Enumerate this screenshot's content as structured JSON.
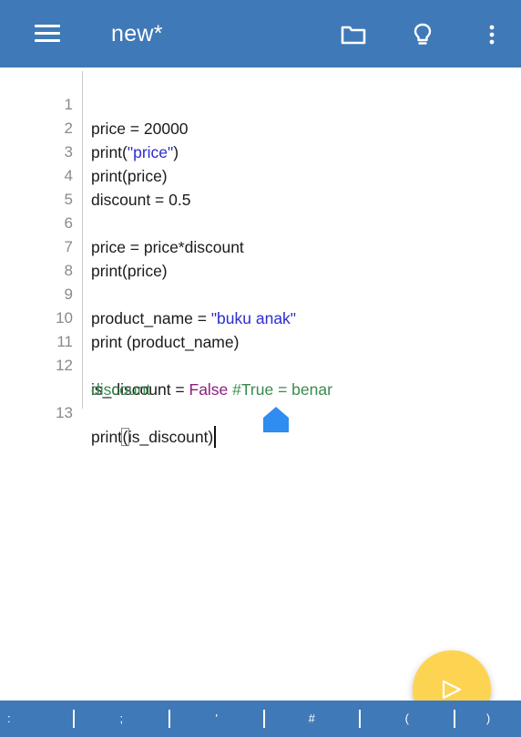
{
  "app_bar": {
    "title": "new*",
    "icons": [
      "menu-icon",
      "folder-icon",
      "lightbulb-icon",
      "more-vert-icon"
    ],
    "color": "#3f79b7"
  },
  "editor": {
    "lines": [
      {
        "num": "1",
        "text": "price = 20000"
      },
      {
        "num": "2",
        "prefix": "print(",
        "string": "\"price\"",
        "suffix": ")"
      },
      {
        "num": "3",
        "text": "print(price)"
      },
      {
        "num": "4",
        "text": "discount = 0.5"
      },
      {
        "num": "5",
        "text": ""
      },
      {
        "num": "6",
        "text": "price = price*discount"
      },
      {
        "num": "7",
        "text": "print(price)"
      },
      {
        "num": "8",
        "text": ""
      },
      {
        "num": "9",
        "prefix": "product_name = ",
        "string": "\"buku anak\""
      },
      {
        "num": "10",
        "text": "print (product_name)"
      },
      {
        "num": "11",
        "text": ""
      },
      {
        "num": "12",
        "prefix": "is_discount = ",
        "keyword": "False",
        "comment": " #True = benar",
        "wrap": "discount"
      },
      {
        "num": "13",
        "before": "print",
        "bracket": "(",
        "after": "is_discount)"
      }
    ],
    "colors": {
      "string": "#2c2ccf",
      "keyword": "#8b1f7a",
      "comment": "#3a8a4d"
    }
  },
  "run_button": {
    "icon": "play-icon",
    "color": "#fdd452"
  },
  "symbol_bar": {
    "symbols": [
      ":",
      ";",
      "'",
      "#",
      "(",
      ")"
    ]
  }
}
